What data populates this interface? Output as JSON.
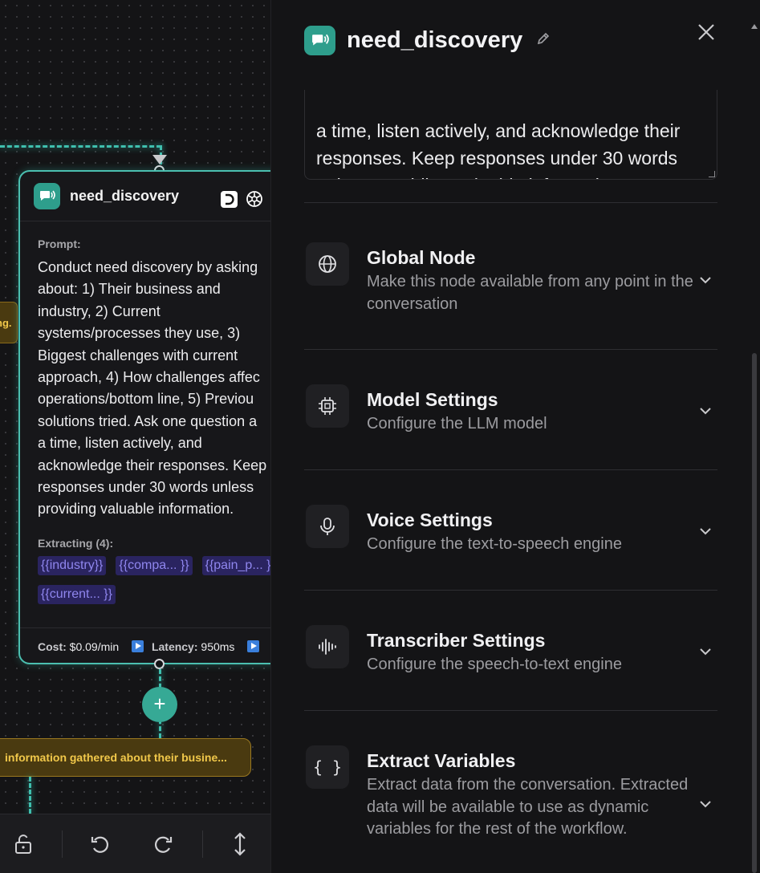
{
  "canvas": {
    "left_tag": "ng.",
    "edge_label": "information gathered about their busine...",
    "node": {
      "title": "need_discovery",
      "prompt_label": "Prompt:",
      "prompt_text": "Conduct need discovery by asking\nabout: 1) Their business and\nindustry, 2) Current\nsystems/processes they use, 3)\nBiggest challenges with current\napproach, 4) How challenges affec\noperations/bottom line, 5) Previou\nsolutions tried. Ask one question a\na time, listen actively, and\nacknowledge their responses. Keep\nresponses under 30 words unless\nproviding valuable information.",
      "extract_label": "Extracting (4):",
      "chips": [
        "{{industry}}",
        "{{compa... }}",
        "{{pain_p... }}",
        "{{current... }}"
      ],
      "cost_label": "Cost:",
      "cost_value": "$0.09/min",
      "latency_label": "Latency:",
      "latency_value": "950ms"
    },
    "toolbar": [
      "unlock-icon",
      "undo-icon",
      "redo-icon",
      "vertical-arrows-icon"
    ]
  },
  "panel": {
    "title": "need_discovery",
    "prompt_excerpt": "a time, listen actively, and acknowledge their\nresponses. Keep responses under 30 words\nunless providing valuable information.",
    "sections": [
      {
        "title": "Global Node",
        "desc": "Make this node available from any point in the conversation",
        "icon": "globe-icon"
      },
      {
        "title": "Model Settings",
        "desc": "Configure the LLM model",
        "icon": "chip-icon"
      },
      {
        "title": "Voice Settings",
        "desc": "Configure the text-to-speech engine",
        "icon": "microphone-icon"
      },
      {
        "title": "Transcriber Settings",
        "desc": "Configure the speech-to-text engine",
        "icon": "waveform-icon"
      },
      {
        "title": "Extract Variables",
        "desc": "Extract data from the conversation. Extracted data will be available to use as dynamic variables for the rest of the workflow.",
        "icon": "braces-icon"
      }
    ]
  },
  "colors": {
    "accent": "#2e9e8c",
    "edge": "#3fbfae",
    "edge_label_bg": "#4a3a10",
    "edge_label_text": "#f1c84a",
    "chip_bg": "#2a2460",
    "chip_text": "#8f86ee"
  }
}
